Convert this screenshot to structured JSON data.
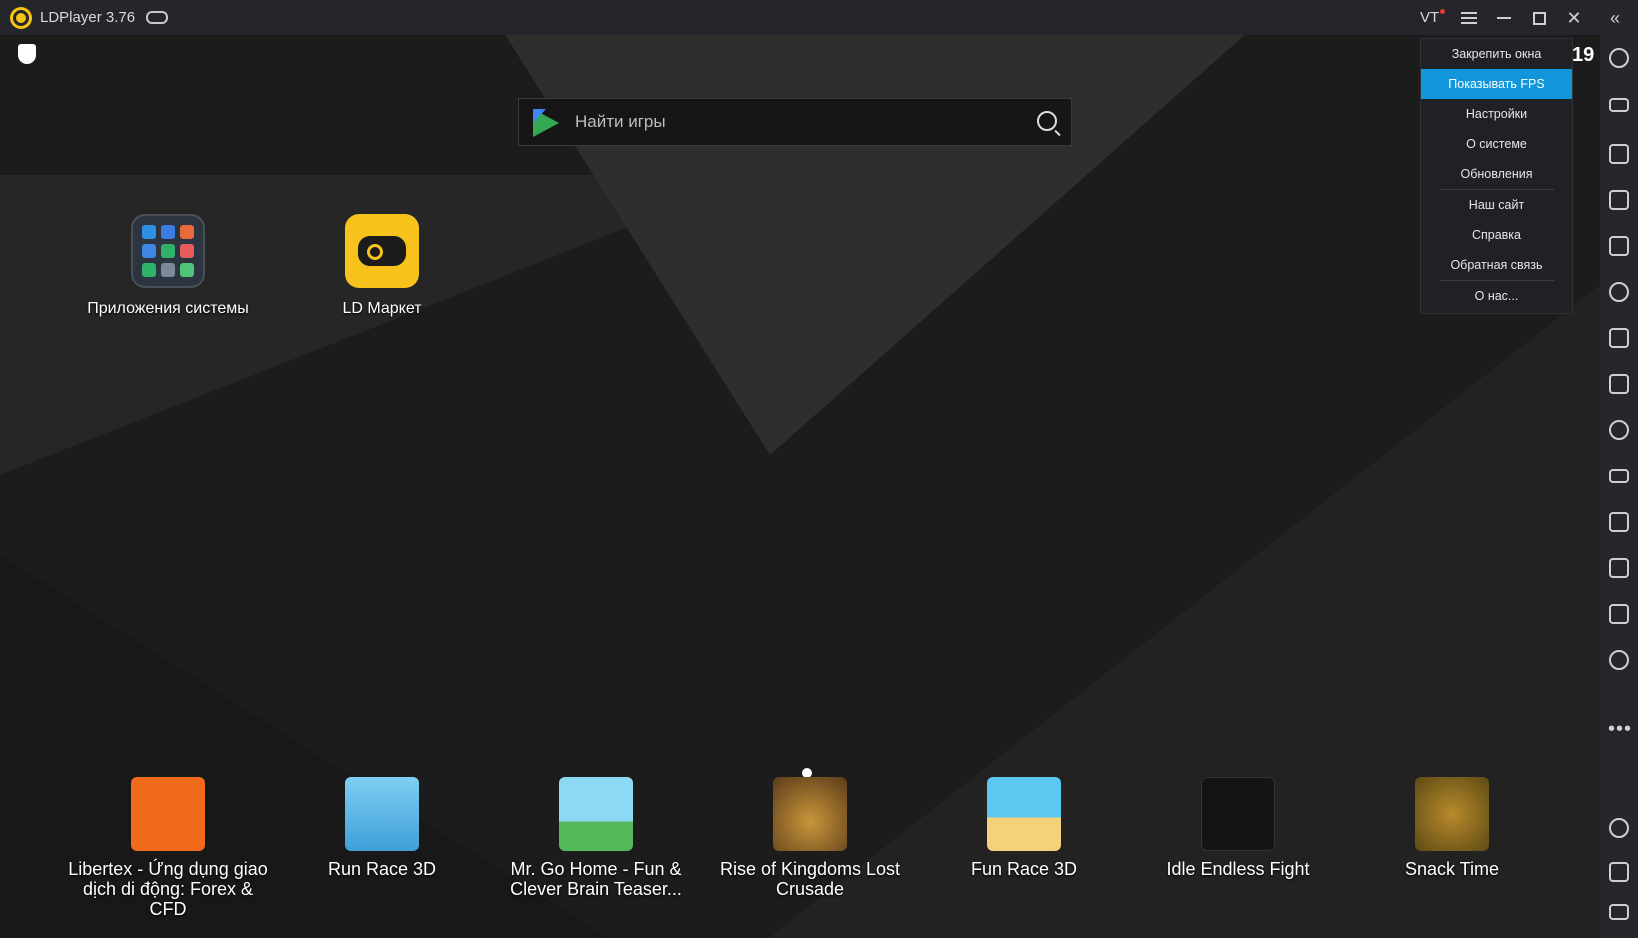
{
  "window": {
    "title": "LDPlayer 3.76",
    "vt_label": "VT",
    "icons": [
      "ldplayer-logo",
      "gamepad",
      "menu",
      "minimize",
      "maximize",
      "close"
    ]
  },
  "search": {
    "placeholder": "Найти игры"
  },
  "desktop_apps": [
    {
      "label": "Приложения системы",
      "icon": "system-apps-folder"
    },
    {
      "label": "LD Маркет",
      "icon": "ld-market"
    }
  ],
  "dock_apps": [
    {
      "label_line1": "Libertex - Ứng dụng giao",
      "label_line2": "dịch di động: Forex & CFD",
      "color": "#f26a1b"
    },
    {
      "label_line1": "Run Race 3D",
      "label_line2": "",
      "color": "#4fb3e8"
    },
    {
      "label_line1": "Mr. Go Home - Fun &",
      "label_line2": "Clever Brain Teaser...",
      "color": "#7fd0f0"
    },
    {
      "label_line1": "Rise of Kingdoms Lost",
      "label_line2": "Crusade",
      "color": "#c9963a"
    },
    {
      "label_line1": "Fun Race 3D",
      "label_line2": "",
      "color": "#5cc8f2"
    },
    {
      "label_line1": "Idle Endless Fight",
      "label_line2": "",
      "color": "#141414"
    },
    {
      "label_line1": "Snack Time",
      "label_line2": "",
      "color": "#c8a02a"
    }
  ],
  "menu": {
    "items": [
      "Закрепить окна",
      "Показывать FPS",
      "Настройки",
      "О системе",
      "Обновления",
      "Наш сайт",
      "Справка",
      "Обратная связь",
      "О нас..."
    ],
    "active_index": 1
  },
  "fps_value": "19",
  "sidebar": {
    "icons": [
      "collapse",
      "settings",
      "keyboard",
      "volume-up",
      "volume-down",
      "fullscreen",
      "record-operation",
      "multi-instance",
      "install-apk",
      "screenshot",
      "video-record",
      "shared-folder",
      "shake",
      "sync",
      "location",
      "more",
      "back",
      "home",
      "recent-apps"
    ]
  },
  "colors": {
    "accent": "#1296db",
    "brand": "#f6c413"
  }
}
